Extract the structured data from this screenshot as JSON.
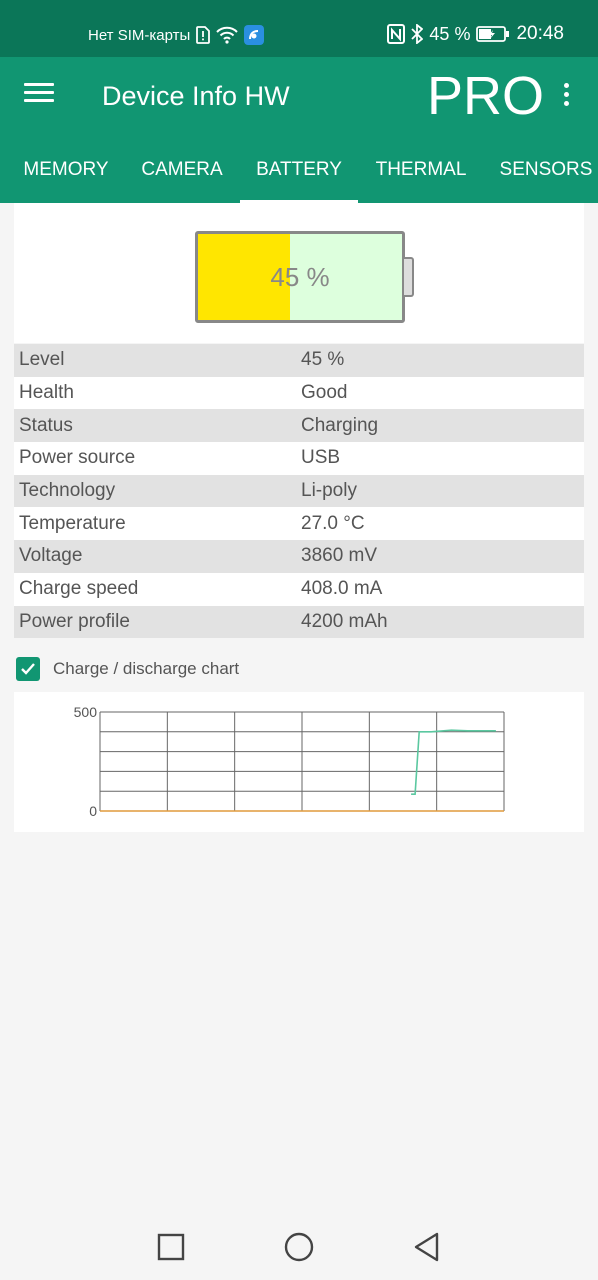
{
  "status_bar": {
    "carrier": "Нет SIM-карты",
    "battery_percent": "45 %",
    "time": "20:48",
    "icons": [
      "sim-alert-icon",
      "wifi-icon",
      "app-notification-icon",
      "nfc-icon",
      "bluetooth-icon",
      "battery-charging-icon"
    ]
  },
  "app_bar": {
    "title": "Device Info HW",
    "pro_label": "PRO",
    "menu_icon": "hamburger-menu-icon",
    "overflow_icon": "more-vertical-icon"
  },
  "tabs": [
    {
      "label": "MEMORY"
    },
    {
      "label": "CAMERA"
    },
    {
      "label": "BATTERY",
      "active": true
    },
    {
      "label": "THERMAL"
    },
    {
      "label": "SENSORS"
    }
  ],
  "battery_widget": {
    "level_text": "45 %",
    "level_fraction": 0.45,
    "fill_color": "#ffe600",
    "empty_color": "#ddffdd"
  },
  "battery_info": [
    {
      "key": "Level",
      "value": "45 %"
    },
    {
      "key": "Health",
      "value": "Good"
    },
    {
      "key": "Status",
      "value": "Charging"
    },
    {
      "key": "Power source",
      "value": "USB"
    },
    {
      "key": "Technology",
      "value": "Li-poly"
    },
    {
      "key": "Temperature",
      "value": "27.0 °C"
    },
    {
      "key": "Voltage",
      "value": "3860 mV"
    },
    {
      "key": "Charge speed",
      "value": "408.0 mA"
    },
    {
      "key": "Power profile",
      "value": "4200 mAh"
    }
  ],
  "chart_toggle": {
    "label": "Charge / discharge chart",
    "checked": true
  },
  "chart_data": {
    "type": "line",
    "title": "",
    "xlabel": "",
    "ylabel": "",
    "ylim": [
      0,
      500
    ],
    "y_tick_labels": [
      "500",
      "0"
    ],
    "grid": true,
    "series": [
      {
        "color": "#5bc8a0",
        "points": [
          [
            0.77,
            85
          ],
          [
            0.78,
            85
          ],
          [
            0.79,
            400
          ],
          [
            0.8,
            400
          ],
          [
            0.82,
            400
          ],
          [
            0.87,
            408
          ],
          [
            0.91,
            405
          ],
          [
            0.98,
            405
          ]
        ]
      },
      {
        "color": "#e09a3c",
        "points": [
          [
            0,
            0
          ],
          [
            1,
            0
          ]
        ]
      }
    ]
  },
  "nav_bar": {
    "icons": [
      "recents-square-icon",
      "home-circle-icon",
      "back-triangle-icon"
    ]
  },
  "colors": {
    "status_bar": "#0b7658",
    "primary": "#119672",
    "row_alt": "#e2e2e2"
  }
}
